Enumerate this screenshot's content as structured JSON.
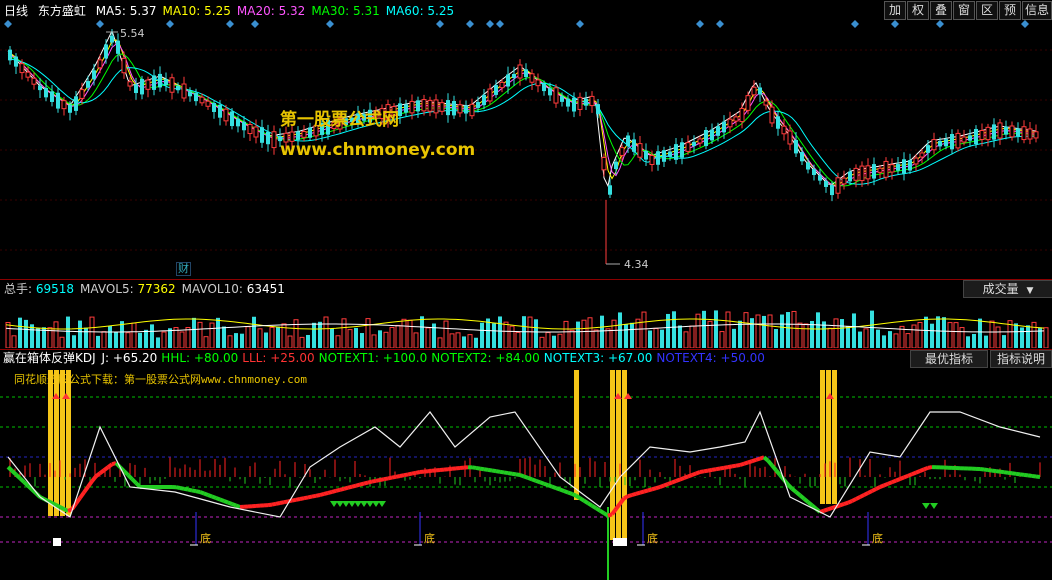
{
  "main_header": {
    "period": "日线",
    "stock_name": "东方盛虹",
    "ma": [
      {
        "label": "MA5: 5.37",
        "color": "#ffffff"
      },
      {
        "label": "MA10: 5.25",
        "color": "#ffff00"
      },
      {
        "label": "MA20: 5.32",
        "color": "#ff55ff"
      },
      {
        "label": "MA30: 5.31",
        "color": "#00ff00"
      },
      {
        "label": "MA60: 5.25",
        "color": "#00ffff"
      }
    ]
  },
  "toolbar": [
    "加",
    "权",
    "叠",
    "窗",
    "区",
    "预",
    "信息"
  ],
  "price_annotations": {
    "high": "5.54",
    "low": "4.34",
    "cai_badge": "财"
  },
  "watermark": {
    "title": "第一股票公式网",
    "url": "www.chnmoney.com"
  },
  "volume_header": {
    "items": [
      {
        "label": "总手: ",
        "value": "69518",
        "color": "#00ffff"
      },
      {
        "label": "MAVOL5: ",
        "value": "77362",
        "color": "#ffff00"
      },
      {
        "label": "MAVOL10: ",
        "value": "63451",
        "color": "#ffffff"
      }
    ],
    "dropdown": "成交量"
  },
  "indicator_header": {
    "name": "赢在箱体反弹KDJ",
    "items": [
      {
        "text": "J: +65.20",
        "color": "#ffffff"
      },
      {
        "text": "HHL: +80.00",
        "color": "#00ff00"
      },
      {
        "text": "LLL: +25.00",
        "color": "#ff3333"
      },
      {
        "text": "NOTEXT1: +100.0",
        "color": "#00ff00"
      },
      {
        "text": "NOTEXT2: +84.00",
        "color": "#00ff00"
      },
      {
        "text": "NOTEXT3: +67.00",
        "color": "#00ffff"
      },
      {
        "text": "NOTEXT4: +50.00",
        "color": "#3333ff"
      }
    ],
    "buttons": [
      "最优指标",
      "指标说明"
    ],
    "subtitle": "同花顺选股公式下载：第一股票公式网www.chnmoney.com",
    "bottom_label": "底"
  }
}
